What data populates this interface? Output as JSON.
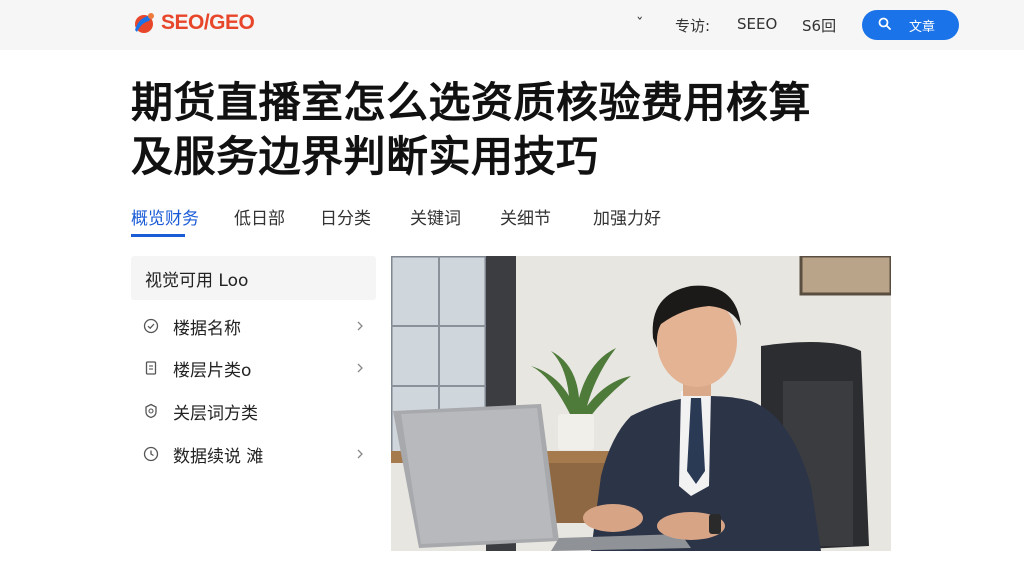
{
  "header": {
    "logo_text": "SEO/GEO",
    "nav": [
      {
        "label": "ˇ"
      },
      {
        "label": "专访:"
      },
      {
        "label": "SEEO"
      },
      {
        "label": "S6回"
      }
    ],
    "search_label": "文章",
    "brand_color": "#e8462a",
    "accent_color": "#1a73e8"
  },
  "article": {
    "title_line1": "期货直播室怎么选资质核验费用核算",
    "title_line2": "及服务边界判断实用技巧"
  },
  "tabs": [
    {
      "label": "概览财务",
      "active": true
    },
    {
      "label": "低日部",
      "active": false
    },
    {
      "label": "日分类",
      "active": false
    },
    {
      "label": "关键词",
      "active": false
    },
    {
      "label": "关细节",
      "active": false
    },
    {
      "label": "加强力好",
      "active": false
    }
  ],
  "sidebar": {
    "heading": "视觉可用 Loo",
    "items": [
      {
        "label": "楼据名称",
        "icon": "check-circle-icon",
        "has_chevron": true
      },
      {
        "label": "楼层片类o",
        "icon": "document-icon",
        "has_chevron": true
      },
      {
        "label": "关层词方类",
        "icon": "badge-icon",
        "has_chevron": false
      },
      {
        "label": "数据续说 滩",
        "icon": "clock-icon",
        "has_chevron": true
      }
    ]
  },
  "photo": {
    "subject": "man-in-suit-using-laptop"
  }
}
